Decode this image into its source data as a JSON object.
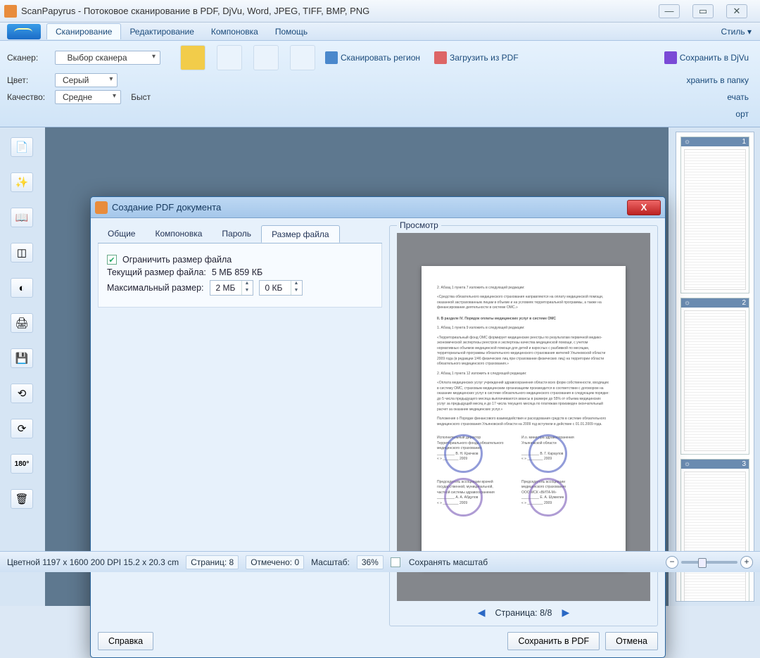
{
  "window": {
    "title": "ScanPapyrus - Потоковое сканирование в PDF, DjVu, Word, JPEG, TIFF, BMP, PNG"
  },
  "ribbon": {
    "tabs": [
      "Сканирование",
      "Редактирование",
      "Компоновка",
      "Помощь"
    ],
    "style": "Стиль ▾",
    "scanner_label": "Сканер:",
    "scanner_combo": "Выбор сканера",
    "color_label": "Цвет:",
    "color_combo": "Серый",
    "quality_label": "Качество:",
    "quality_combo": "Средне",
    "quick": "Быст",
    "scan_region": "Сканировать регион",
    "load_pdf": "Загрузить из PDF",
    "save_djvu": "Сохранить в DjVu",
    "save_folder": "хранить в папку",
    "print": "ечать",
    "export": "орт"
  },
  "thumbs": [
    {
      "num": "1",
      "icon": "☼"
    },
    {
      "num": "2",
      "icon": "☼"
    },
    {
      "num": "3",
      "icon": "☼"
    }
  ],
  "status": {
    "info": "Цветной  1197 x 1600  200 DPI  15.2 x 20.3 cm",
    "pages": "Страниц: 8",
    "marked": "Отмечено: 0",
    "zoom_label": "Масштаб:",
    "zoom_val": "36%",
    "keep_zoom": "Сохранять масштаб"
  },
  "dialog": {
    "title": "Создание PDF документа",
    "tabs": [
      "Общие",
      "Компоновка",
      "Пароль",
      "Размер файла"
    ],
    "limit_label": "Ограничить размер файла",
    "cur_prefix": "Текущий размер файла:",
    "cur_val": "5 МБ 859 КБ",
    "max_label": "Максимальный размер:",
    "mb_val": "2 МБ",
    "kb_val": "0 КБ",
    "help": "Справка",
    "preview_label": "Просмотр",
    "page_nav": "Страница:  8/8",
    "save": "Сохранить в PDF",
    "cancel": "Отмена"
  }
}
